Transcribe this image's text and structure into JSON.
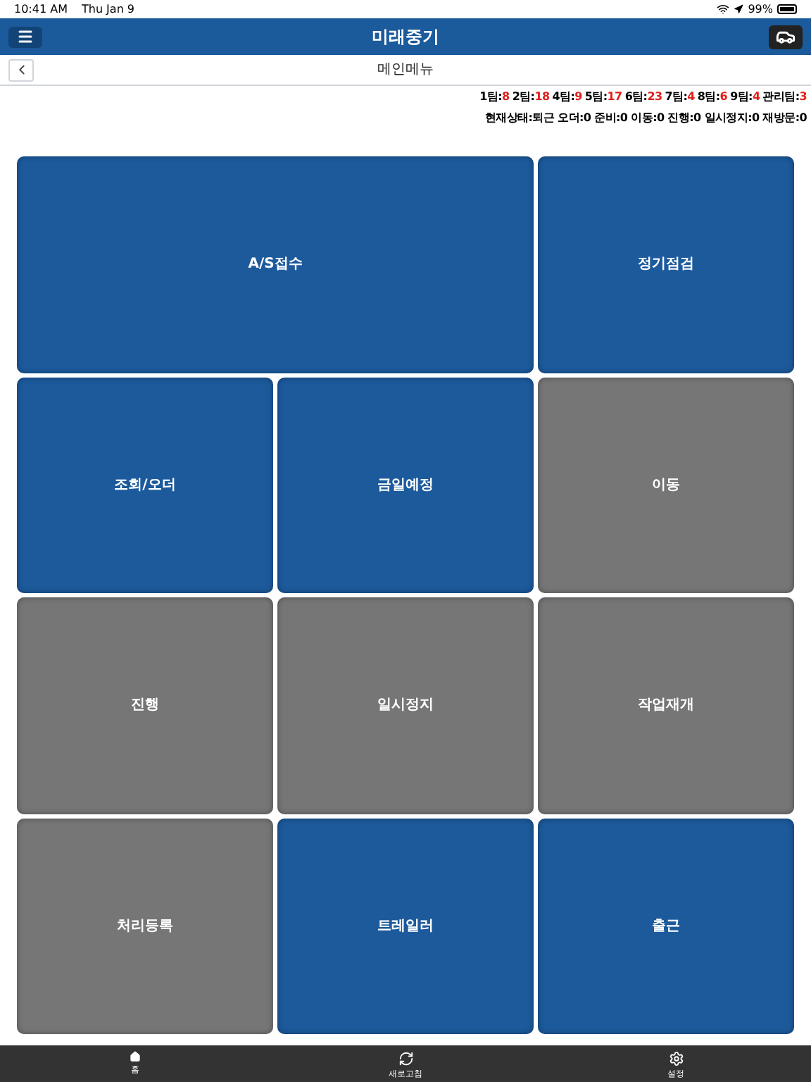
{
  "status_bar": {
    "time": "10:41 AM",
    "date": "Thu Jan 9",
    "battery": "99%"
  },
  "header": {
    "title": "미래중기"
  },
  "subheader": {
    "title": "메인메뉴"
  },
  "teams": [
    {
      "label": "1팀:",
      "count": "8"
    },
    {
      "label": "2팀:",
      "count": "18"
    },
    {
      "label": "4팀:",
      "count": "9"
    },
    {
      "label": "5팀:",
      "count": "17"
    },
    {
      "label": "6팀:",
      "count": "23"
    },
    {
      "label": "7팀:",
      "count": "4"
    },
    {
      "label": "8팀:",
      "count": "6"
    },
    {
      "label": "9팀:",
      "count": "4"
    },
    {
      "label": "관리팀:",
      "count": "3"
    }
  ],
  "current_status": "현재상태:퇴근 오더:0 준비:0 이동:0 진행:0 일시정지:0 재방문:0",
  "tiles": [
    {
      "label": "A/S접수",
      "enabled": true,
      "wide": true
    },
    {
      "label": "정기점검",
      "enabled": true,
      "wide": false
    },
    {
      "label": "조회/오더",
      "enabled": true,
      "wide": false
    },
    {
      "label": "금일예정",
      "enabled": true,
      "wide": false
    },
    {
      "label": "이동",
      "enabled": false,
      "wide": false
    },
    {
      "label": "진행",
      "enabled": false,
      "wide": false
    },
    {
      "label": "일시정지",
      "enabled": false,
      "wide": false
    },
    {
      "label": "작업재개",
      "enabled": false,
      "wide": false
    },
    {
      "label": "처리등록",
      "enabled": false,
      "wide": false
    },
    {
      "label": "트레일러",
      "enabled": true,
      "wide": false
    },
    {
      "label": "출근",
      "enabled": true,
      "wide": false
    }
  ],
  "tab_bar": [
    {
      "label": "홈",
      "kind": "home"
    },
    {
      "label": "새로고침",
      "kind": "refresh"
    },
    {
      "label": "설정",
      "kind": "settings"
    }
  ]
}
